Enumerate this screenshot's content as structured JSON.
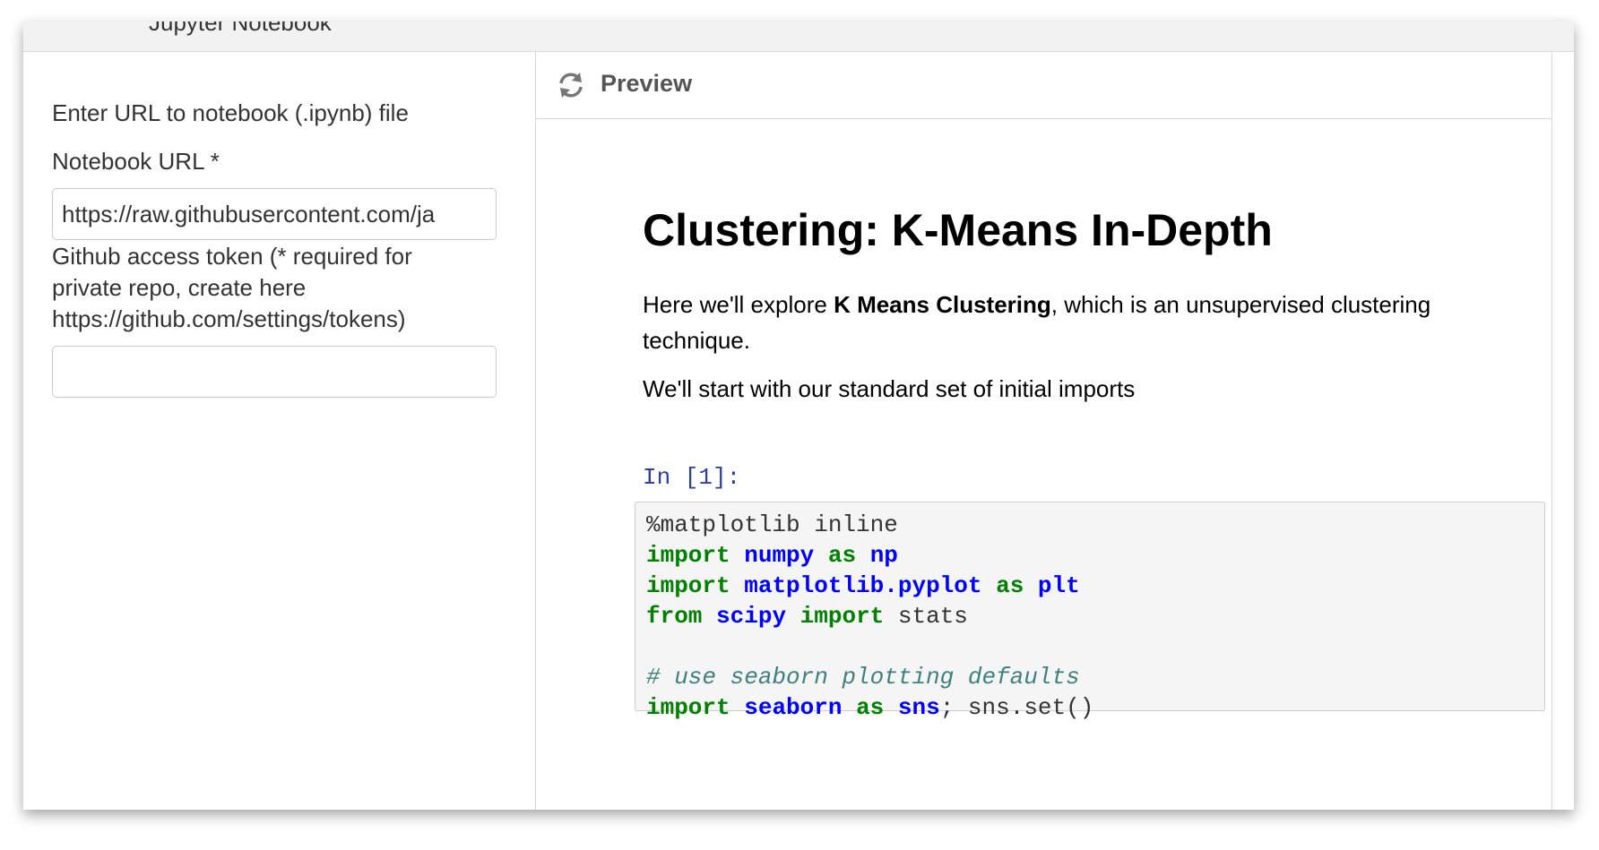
{
  "window": {
    "title": "Jupyter Notebook"
  },
  "left": {
    "heading": "Enter URL to notebook (.ipynb) file",
    "url_label": "Notebook URL *",
    "url_value": "https://raw.githubusercontent.com/ja",
    "token_label_line1": "Github access token (* required for",
    "token_label_line2": "private repo, create here",
    "token_label_line3": "https://github.com/settings/tokens)",
    "token_value": ""
  },
  "preview": {
    "header": "Preview",
    "title": "Clustering: K-Means In-Depth",
    "intro_pre": "Here we'll explore ",
    "intro_bold": "K Means Clustering",
    "intro_post": ", which is an unsupervised clustering",
    "intro_line2": "technique.",
    "para2": "We'll start with our standard set of initial imports",
    "prompt": "In [1]:",
    "code": {
      "l1": "%matplotlib inline",
      "l2_kw": "import",
      "l2_mod": "numpy",
      "l2_as": "as",
      "l2_alias": "np",
      "l3_kw": "import",
      "l3_mod": "matplotlib.pyplot",
      "l3_as": "as",
      "l3_alias": "plt",
      "l4_from": "from",
      "l4_mod": "scipy",
      "l4_import": "import",
      "l4_name": "stats",
      "l6_comment": "# use seaborn plotting defaults",
      "l7_kw": "import",
      "l7_mod": "seaborn",
      "l7_as": "as",
      "l7_alias": "sns",
      "l7_rest": "sns.set()"
    }
  }
}
